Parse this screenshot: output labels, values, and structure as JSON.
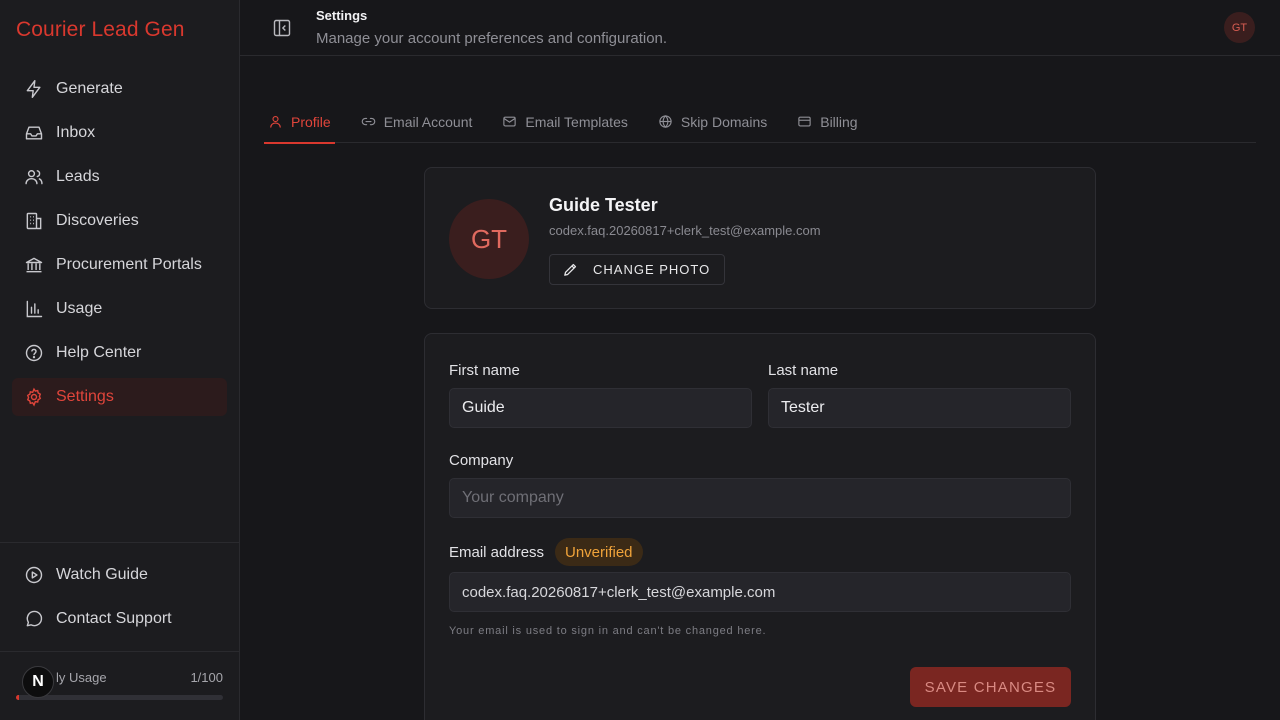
{
  "app": {
    "brand": "Courier Lead Gen"
  },
  "sidebar": {
    "items": [
      {
        "label": "Generate",
        "icon": "bolt-icon"
      },
      {
        "label": "Inbox",
        "icon": "inbox-icon"
      },
      {
        "label": "Leads",
        "icon": "users-icon"
      },
      {
        "label": "Discoveries",
        "icon": "building-icon"
      },
      {
        "label": "Procurement Portals",
        "icon": "landmark-icon"
      },
      {
        "label": "Usage",
        "icon": "bar-chart-icon"
      },
      {
        "label": "Help Center",
        "icon": "help-circle-icon"
      },
      {
        "label": "Settings",
        "icon": "gear-icon",
        "active": true
      }
    ],
    "bottom_items": [
      {
        "label": "Watch Guide",
        "icon": "play-circle-icon"
      },
      {
        "label": "Contact Support",
        "icon": "message-circle-icon"
      }
    ],
    "usage": {
      "label": "Monthly Usage",
      "label_visible": "ly Usage",
      "value": "1/100",
      "fraction": 0.01
    },
    "n_badge": "N"
  },
  "header": {
    "title": "Settings",
    "subtitle": "Manage your account preferences and configuration.",
    "avatar_initials": "GT"
  },
  "tabs": [
    {
      "label": "Profile",
      "icon": "user-icon",
      "active": true
    },
    {
      "label": "Email Account",
      "icon": "link-icon"
    },
    {
      "label": "Email Templates",
      "icon": "mail-icon"
    },
    {
      "label": "Skip Domains",
      "icon": "globe-icon"
    },
    {
      "label": "Billing",
      "icon": "credit-card-icon"
    }
  ],
  "profile": {
    "initials": "GT",
    "name": "Guide Tester",
    "email": "codex.faq.20260817+clerk_test@example.com",
    "change_photo_label": "CHANGE PHOTO"
  },
  "form": {
    "first_name_label": "First name",
    "first_name_value": "Guide",
    "last_name_label": "Last name",
    "last_name_value": "Tester",
    "company_label": "Company",
    "company_placeholder": "Your company",
    "email_label": "Email address",
    "email_badge": "Unverified",
    "email_value": "codex.faq.20260817+clerk_test@example.com",
    "email_hint": "Your email is used to sign in and can't be changed here.",
    "save_label": "SAVE CHANGES"
  },
  "colors": {
    "accent": "#d9382e",
    "background": "#17171a",
    "sidebar": "#1c1c1f",
    "warning": "#f0a33a"
  }
}
